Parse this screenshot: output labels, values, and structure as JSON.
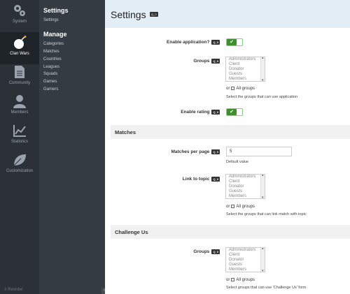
{
  "rail": {
    "items": [
      {
        "label": "System",
        "icon": "gears-icon"
      },
      {
        "label": "Clan Wars",
        "icon": "bomb-icon"
      },
      {
        "label": "Community",
        "icon": "document-icon"
      },
      {
        "label": "Members",
        "icon": "user-icon"
      },
      {
        "label": "Statistics",
        "icon": "chart-icon"
      },
      {
        "label": "Customization",
        "icon": "leaf-icon"
      }
    ],
    "footer": "≡ Reorder",
    "collapse": "‹"
  },
  "subnav": {
    "settings_title": "Settings",
    "settings_link": "Settings",
    "manage_title": "Manage",
    "manage_links": [
      "Categories",
      "Matches",
      "Countries",
      "Leagues",
      "Squads",
      "Games",
      "Gamers"
    ]
  },
  "page": {
    "title": "Settings",
    "tag": "Q_0"
  },
  "form": {
    "enable_application": {
      "label": "Enable application?",
      "tag": "Q_0",
      "checkmark": "✔"
    },
    "groups": {
      "label": "Groups",
      "tag": "Q_0",
      "options": [
        "Administrators",
        "Client",
        "Donator",
        "Guests",
        "Members"
      ],
      "or": "or",
      "all": "All groups",
      "help": "Select the groups that can use application"
    },
    "enable_rating": {
      "label": "Enable rating",
      "tag": "Q_0",
      "checkmark": "✔"
    },
    "matches_section": "Matches",
    "matches_per_page": {
      "label": "Matches per page",
      "tag": "Q_0",
      "value": "5",
      "help": "Default value"
    },
    "link_to_topic": {
      "label": "Link to topic",
      "tag": "Q_0",
      "options": [
        "Administrators",
        "Client",
        "Donator",
        "Guests",
        "Members"
      ],
      "or": "or",
      "all": "All groups",
      "help": "Select the groups that can link match with topic"
    },
    "challenge_section": "Challenge Us",
    "challenge_groups": {
      "label": "Groups",
      "tag": "Q_0",
      "options": [
        "Administrators",
        "Client",
        "Donator",
        "Guests",
        "Members"
      ],
      "or": "or",
      "all": "All groups",
      "help": "Select groups that can use 'Challenge Us' form"
    }
  }
}
